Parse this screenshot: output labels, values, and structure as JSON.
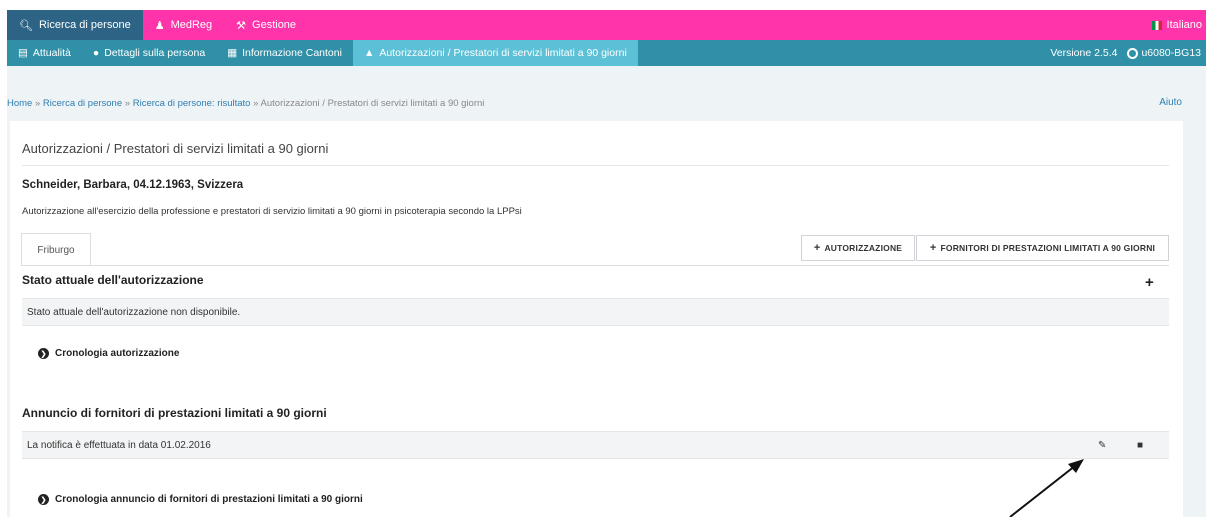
{
  "topnav": {
    "tabs": [
      {
        "label": "Ricerca di persone",
        "icon": "search-icon"
      },
      {
        "label": "MedReg",
        "icon": "users-icon"
      },
      {
        "label": "Gestione",
        "icon": "wrench-icon"
      }
    ],
    "language": "Italiano"
  },
  "subnav": {
    "tabs": [
      {
        "label": "Attualità",
        "icon": "news-icon"
      },
      {
        "label": "Dettagli sulla persona",
        "icon": "person-icon"
      },
      {
        "label": "Informazione Cantoni",
        "icon": "grid-icon"
      },
      {
        "label": "Autorizzazioni / Prestatori di servizi limitati a 90 giorni",
        "icon": "graduation-cap-icon"
      }
    ],
    "version": "Versione 2.5.4",
    "user": "u6080-BG13"
  },
  "breadcrumb": {
    "items": [
      "Home",
      "Ricerca di persone",
      "Ricerca di persone: risultato"
    ],
    "separator": "»",
    "current": "Autorizzazioni / Prestatori di servizi limitati a 90 giorni"
  },
  "help": "Aiuto",
  "card": {
    "title": "Autorizzazioni / Prestatori di servizi limitati a 90 giorni",
    "person": "Schneider, Barbara, 04.12.1963, Svizzera",
    "description": "Autorizzazione all'esercizio della professione e prestatori di servizio limitati a 90 giorni in psicoterapia secondo la LPPsi",
    "canton_tab": "Friburgo",
    "btn_authorization": "AUTORIZZAZIONE",
    "btn_providers": "FORNITORI DI PRESTAZIONI LIMITATI A 90 GIORNI",
    "status_title": "Stato attuale dell'autorizzazione",
    "status_text": "Stato attuale dell'autorizzazione non disponibile.",
    "history_toggle": "Cronologia autorizzazione",
    "announcement_title": "Annuncio di fornitori di prestazioni limitati a 90 giorni",
    "announcement_text": "La notifica è effettuata in data 01.02.2016",
    "announcement_history_toggle": "Cronologia annuncio di fornitori di prestazioni limitati a 90 giorni"
  },
  "colors": {
    "topbar": "#ff33aa",
    "topbar_active": "#2d6486",
    "subbar": "#2f90a8",
    "subbar_active": "#5cc0d6",
    "link": "#2f7fb0"
  }
}
